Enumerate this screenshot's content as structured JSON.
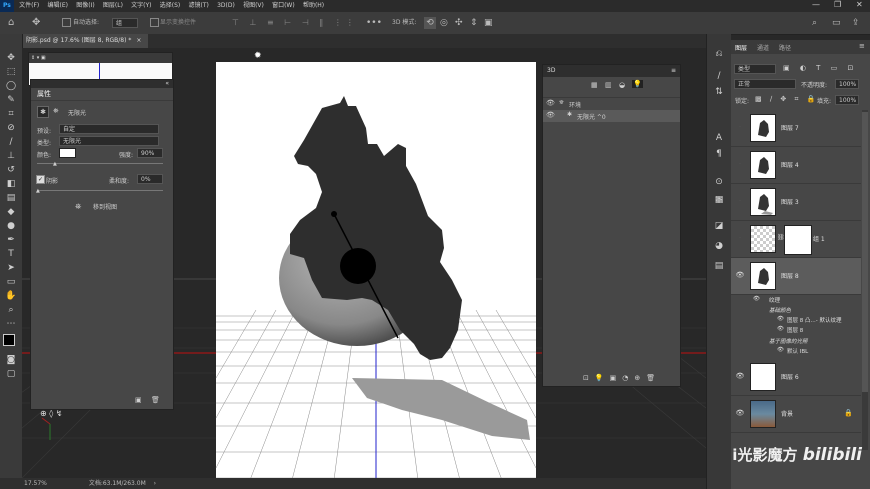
{
  "menu": {
    "ps_logo": "Ps",
    "items": [
      "文件(F)",
      "编辑(E)",
      "图像(I)",
      "图层(L)",
      "文字(Y)",
      "选择(S)",
      "滤镜(T)",
      "3D(D)",
      "视图(V)",
      "窗口(W)",
      "帮助(H)"
    ]
  },
  "options": {
    "auto_select": "自动选择:",
    "auto_select_value": "组",
    "show_transform": "显示变换控件",
    "mode_3d": "3D 模式:"
  },
  "document": {
    "tab_title": "阴影.psd @ 17.6% (图层 8, RGB/8) *"
  },
  "properties": {
    "title": "属性",
    "light_type_label": "无限光",
    "preset_label": "预设:",
    "preset_value": "自定",
    "type_label": "类型:",
    "type_value": "无限光",
    "color_label": "颜色:",
    "intensity_label": "强度:",
    "intensity_value": "90%",
    "shadow_label": "阴影",
    "softness_label": "柔和度:",
    "softness_value": "0%",
    "move_to_view": "移到视图"
  },
  "panel3d": {
    "title": "3D",
    "items": [
      {
        "label": "环境"
      },
      {
        "label": "无限光 ^0"
      }
    ]
  },
  "layers": {
    "tabs": [
      "图层",
      "通道",
      "路径"
    ],
    "filter": "类型",
    "blend_mode": "正常",
    "opacity_label": "不透明度:",
    "opacity_value": "100%",
    "lock_label": "锁定:",
    "fill_label": "填充:",
    "fill_value": "100%",
    "rows": [
      {
        "name": "图层 7"
      },
      {
        "name": "图层 4"
      },
      {
        "name": "图层 3"
      },
      {
        "name": "组 1"
      },
      {
        "name": "图层 8"
      },
      {
        "name": "图层 6"
      },
      {
        "name": "背景"
      }
    ],
    "sub_items": [
      "纹理",
      "基础颜色",
      "图层 8 凸...- 默认纹理",
      "图层 8",
      "基于图像的光照",
      "默认 IBL"
    ]
  },
  "status": {
    "zoom": "17.57%",
    "doc": "文档:63.1M/263.0M"
  },
  "watermark": {
    "text": "i光影魔方",
    "logo": "bilibili"
  }
}
